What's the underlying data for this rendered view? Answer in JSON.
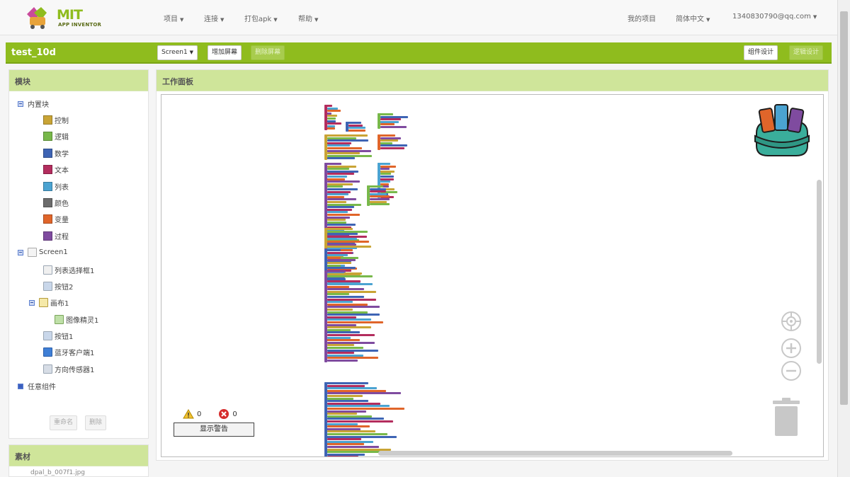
{
  "topbar": {
    "logo_title": "MIT",
    "logo_subtitle": "APP INVENTOR",
    "menus": [
      "项目",
      "连接",
      "打包apk",
      "帮助"
    ],
    "my_projects": "我的项目",
    "language": "简体中文",
    "account": "1340830790@qq.com"
  },
  "toolbar": {
    "project_name": "test_10d",
    "screen_select": "Screen1",
    "add_screen": "增加屏幕",
    "remove_screen": "删除屏幕",
    "designer": "组件设计",
    "blocks": "逻辑设计"
  },
  "blocks_panel": {
    "title": "模块",
    "builtin_label": "内置块",
    "builtin": [
      {
        "label": "控制",
        "color": "#c9a435"
      },
      {
        "label": "逻辑",
        "color": "#78b84a"
      },
      {
        "label": "数学",
        "color": "#3e64b4"
      },
      {
        "label": "文本",
        "color": "#b32d5e"
      },
      {
        "label": "列表",
        "color": "#4ba3d1"
      },
      {
        "label": "颜色",
        "color": "#6c6c6c"
      },
      {
        "label": "变量",
        "color": "#e0652a"
      },
      {
        "label": "过程",
        "color": "#7f4b9f"
      }
    ],
    "screen_label": "Screen1",
    "components": [
      "列表选择框1",
      "按钮2",
      "画布1",
      "图像精灵1",
      "按钮1",
      "蓝牙客户端1",
      "方向传感器1"
    ],
    "any_component": "任意组件",
    "rename_button": "重命名",
    "delete_button": "删除"
  },
  "media_panel": {
    "title": "素材",
    "first_item": "dpal_b_007f1.jpg"
  },
  "workspace": {
    "title": "工作面板",
    "warning_count": "0",
    "error_count": "0",
    "show_warnings_button": "显示警告"
  },
  "colors": {
    "brand_green": "#8fbc1e",
    "header_green": "#cfe59a"
  }
}
